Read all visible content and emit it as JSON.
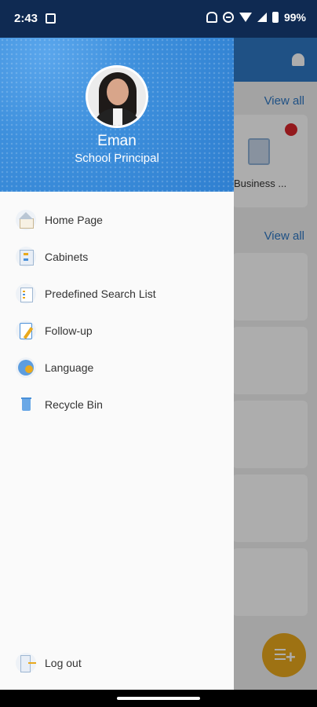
{
  "status_bar": {
    "time": "2:43",
    "battery": "99%"
  },
  "background": {
    "view_all_1": "View all",
    "view_all_2": "View all",
    "card_label": "Business ..."
  },
  "drawer": {
    "user_name": "Eman",
    "user_role": "School Principal",
    "menu": [
      {
        "label": "Home Page",
        "icon": "home-icon"
      },
      {
        "label": "Cabinets",
        "icon": "cabinet-icon"
      },
      {
        "label": "Predefined Search List",
        "icon": "search-list-icon"
      },
      {
        "label": "Follow-up",
        "icon": "clipboard-icon"
      },
      {
        "label": "Language",
        "icon": "globe-icon"
      },
      {
        "label": "Recycle Bin",
        "icon": "trash-icon"
      }
    ],
    "logout_label": "Log out"
  }
}
